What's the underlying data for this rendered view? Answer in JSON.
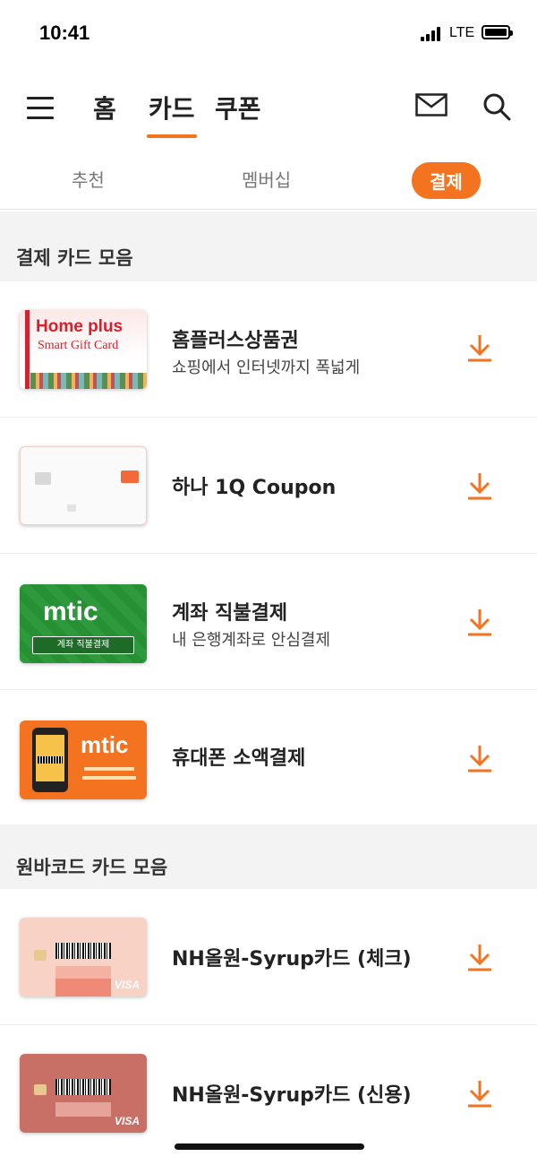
{
  "status_bar": {
    "time": "10:41",
    "network": "LTE"
  },
  "top_nav": {
    "tabs": [
      "홈",
      "카드",
      "쿠폰"
    ],
    "active_tab": "카드"
  },
  "sub_tabs": {
    "items": [
      "추천",
      "멤버십",
      "결제"
    ],
    "active": "결제"
  },
  "sections": [
    {
      "title": "결제 카드 모음",
      "items": [
        {
          "title": "홈플러스상품권",
          "subtitle": "쇼핑에서 인터넷까지 폭넓게",
          "thumb_logo": "Home plus",
          "thumb_sub": "Smart Gift Card"
        },
        {
          "title": "하나 1Q Coupon",
          "subtitle": "",
          "thumb_logo": "",
          "thumb_sub": ""
        },
        {
          "title": "계좌 직불결제",
          "subtitle": "내 은행계좌로 안심결제",
          "thumb_logo": "mtic",
          "thumb_sub": "계좌 직불결제"
        },
        {
          "title": "휴대폰 소액결제",
          "subtitle": "",
          "thumb_logo": "mtic",
          "thumb_sub": ""
        }
      ]
    },
    {
      "title": "원바코드 카드 모음",
      "items": [
        {
          "title": "NH올원-Syrup카드 (체크)",
          "subtitle": "",
          "thumb_logo": "VISA",
          "thumb_sub": ""
        },
        {
          "title": "NH올원-Syrup카드 (신용)",
          "subtitle": "",
          "thumb_logo": "VISA",
          "thumb_sub": ""
        }
      ]
    }
  ],
  "colors": {
    "accent": "#f37321",
    "section_bg": "#f3f3f3",
    "text": "#222222"
  },
  "icons": {
    "menu": "hamburger-icon",
    "mail": "mail-icon",
    "search": "search-icon",
    "download": "download-icon"
  }
}
